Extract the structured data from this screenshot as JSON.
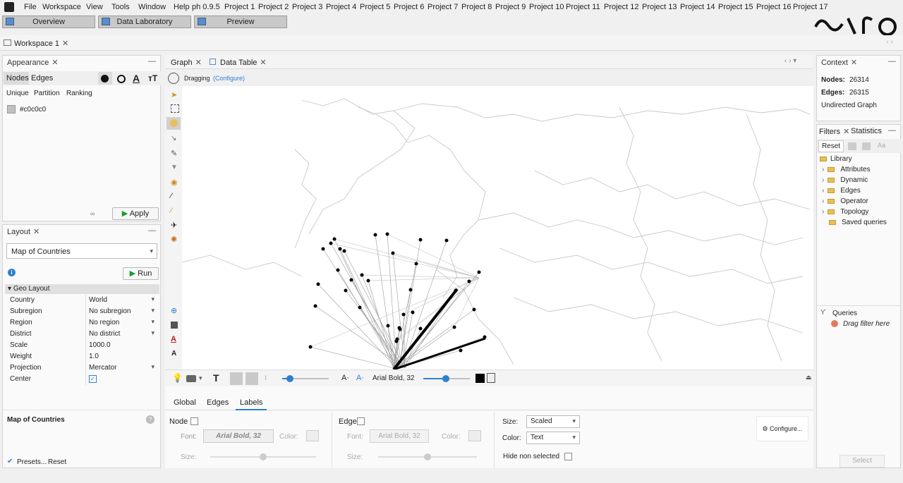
{
  "menubar": {
    "items": [
      "File",
      "Workspace",
      "View",
      "Tools",
      "Window",
      "Help"
    ],
    "projects": [
      "ph 0.9.5",
      "Project 1",
      "Project 2",
      "Project 3",
      "Project 4",
      "Project 5",
      "Project 6",
      "Project 7",
      "Project 8",
      "Project 9",
      "Project 10",
      "Project 11",
      "Project 12",
      "Project 13",
      "Project 14",
      "Project 15",
      "Project 16",
      "Project 17"
    ]
  },
  "modes": [
    "Overview",
    "Data Laboratory",
    "Preview"
  ],
  "workspace_tab": "Workspace 1",
  "appearance": {
    "title": "Appearance",
    "tabs": [
      "Nodes",
      "Edges"
    ],
    "subtabs": [
      "Unique",
      "Partition",
      "Ranking"
    ],
    "color_value": "#c0c0c0",
    "apply_label": "Apply"
  },
  "layout": {
    "title": "Layout",
    "algorithm": "Map of Countries",
    "run_label": "Run",
    "section": "Geo Layout",
    "props": [
      {
        "key": "Country",
        "value": "World",
        "dropdown": true
      },
      {
        "key": "Subregion",
        "value": "No subregion",
        "dropdown": true
      },
      {
        "key": "Region",
        "value": "No region",
        "dropdown": true
      },
      {
        "key": "District",
        "value": "No district",
        "dropdown": true
      },
      {
        "key": "Scale",
        "value": "1000.0",
        "dropdown": false
      },
      {
        "key": "Weight",
        "value": "1.0",
        "dropdown": false
      },
      {
        "key": "Projection",
        "value": "Mercator",
        "dropdown": true
      },
      {
        "key": "Center",
        "value": "",
        "dropdown": false
      }
    ],
    "desc_title": "Map of Countries",
    "presets_label": "Presets...",
    "reset_label": "Reset"
  },
  "graph": {
    "tabs": [
      "Graph",
      "Data Table"
    ],
    "mode_label": "Dragging",
    "configure_label": "(Configure)",
    "font_label": "Arial Bold, 32"
  },
  "bottom_tabs": [
    "Global",
    "Edges",
    "Labels"
  ],
  "labels_panel": {
    "node_label": "Node",
    "edge_label": "Edge",
    "font_label": "Font:",
    "color_label": "Color:",
    "size_label": "Size:",
    "node_font": "Arial Bold, 32",
    "edge_font": "Arial Bold, 32",
    "size_key": "Size:",
    "size_value": "Scaled",
    "color_key": "Color:",
    "color_value": "Text",
    "hide_label": "Hide non selected",
    "configure_label": "Configure..."
  },
  "context": {
    "title": "Context",
    "nodes_key": "Nodes:",
    "nodes_value": "26314",
    "edges_key": "Edges:",
    "edges_value": "26315",
    "graph_type": "Undirected Graph"
  },
  "filters": {
    "tabs": [
      "Filters",
      "Statistics"
    ],
    "reset_label": "Reset",
    "library_label": "Library",
    "items": [
      "Attributes",
      "Dynamic",
      "Edges",
      "Operator",
      "Topology",
      "Saved queries"
    ],
    "queries_label": "Queries",
    "drag_hint": "Drag filter here",
    "select_label": "Select"
  },
  "colors": {
    "accent": "#2f7fd1",
    "panel_bg": "#fafafa",
    "edge_dark": "#000000"
  }
}
